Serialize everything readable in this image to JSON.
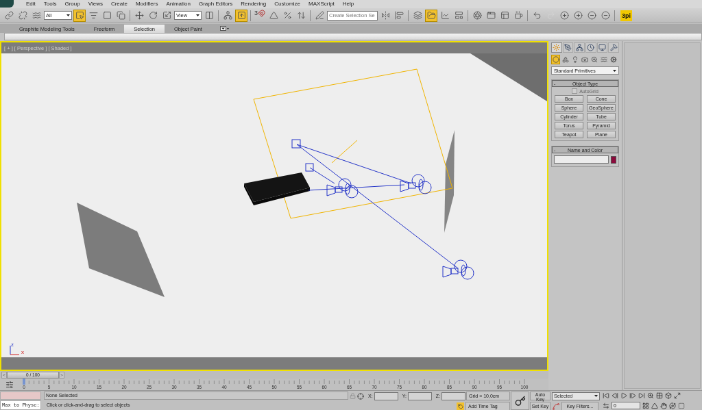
{
  "menu": [
    "Edit",
    "Tools",
    "Group",
    "Views",
    "Create",
    "Modifiers",
    "Animation",
    "Graph Editors",
    "Rendering",
    "Customize",
    "MAXScript",
    "Help"
  ],
  "toolbar": [
    {
      "kind": "button",
      "active": false,
      "disabled": false
    },
    {
      "kind": "button",
      "active": false,
      "disabled": false
    },
    {
      "kind": "button",
      "active": false,
      "disabled": false
    },
    {
      "kind": "dropdown",
      "value": "All"
    },
    {
      "kind": "button",
      "active": true,
      "disabled": false
    },
    {
      "kind": "button",
      "active": false,
      "disabled": false
    },
    {
      "kind": "button",
      "active": false,
      "disabled": false
    },
    {
      "kind": "button",
      "active": false,
      "disabled": false
    },
    {
      "kind": "separator"
    },
    {
      "kind": "button",
      "active": false,
      "disabled": false
    },
    {
      "kind": "button",
      "active": false,
      "disabled": false
    },
    {
      "kind": "button",
      "active": false,
      "disabled": false
    },
    {
      "kind": "dropdown",
      "value": "View"
    },
    {
      "kind": "button",
      "active": false,
      "disabled": false
    },
    {
      "kind": "separator"
    },
    {
      "kind": "button",
      "active": false,
      "disabled": false
    },
    {
      "kind": "button",
      "active": true,
      "disabled": false
    },
    {
      "kind": "separator"
    },
    {
      "kind": "snap",
      "text": "3"
    },
    {
      "kind": "button",
      "active": false,
      "disabled": false
    },
    {
      "kind": "button",
      "active": false,
      "disabled": false
    },
    {
      "kind": "button",
      "active": false,
      "disabled": false
    },
    {
      "kind": "separator"
    },
    {
      "kind": "button",
      "active": false,
      "disabled": false
    },
    {
      "kind": "field",
      "placeholder": "Create Selection Se"
    },
    {
      "kind": "button",
      "active": false,
      "disabled": false
    },
    {
      "kind": "button",
      "active": false,
      "disabled": false
    },
    {
      "kind": "separator"
    },
    {
      "kind": "button",
      "active": false,
      "disabled": false
    },
    {
      "kind": "button",
      "active": true,
      "disabled": false
    },
    {
      "kind": "button",
      "active": false,
      "disabled": false
    },
    {
      "kind": "button",
      "active": false,
      "disabled": false
    },
    {
      "kind": "separator"
    },
    {
      "kind": "button",
      "active": false,
      "disabled": false
    },
    {
      "kind": "button",
      "active": false,
      "disabled": false
    },
    {
      "kind": "button",
      "active": false,
      "disabled": false
    },
    {
      "kind": "button",
      "active": false,
      "disabled": false
    },
    {
      "kind": "separator"
    },
    {
      "kind": "button",
      "active": false,
      "disabled": false
    },
    {
      "kind": "button",
      "active": false,
      "disabled": true
    },
    {
      "kind": "button",
      "active": false,
      "disabled": false
    },
    {
      "kind": "button",
      "active": false,
      "disabled": false
    },
    {
      "kind": "button",
      "active": false,
      "disabled": false
    },
    {
      "kind": "button",
      "active": false,
      "disabled": false
    },
    {
      "kind": "separator"
    },
    {
      "kind": "badge",
      "text": "3pi"
    }
  ],
  "ribbon": {
    "tabs": [
      {
        "label": "Graphite Modeling Tools",
        "selected": false
      },
      {
        "label": "Freeform",
        "selected": false
      },
      {
        "label": "Selection",
        "selected": true
      },
      {
        "label": "Object Paint",
        "selected": false
      }
    ]
  },
  "viewport": {
    "label": "[ + ] [ Perspective ] [ Shaded ]",
    "axis_labels": [
      "z",
      "x"
    ]
  },
  "command_panel": {
    "tabs": [
      {
        "selected": true
      },
      {
        "selected": false
      },
      {
        "selected": false
      },
      {
        "selected": false
      },
      {
        "selected": false
      },
      {
        "selected": false
      }
    ],
    "categories": [
      {
        "selected": true
      },
      {
        "selected": false
      },
      {
        "selected": false
      },
      {
        "selected": false
      },
      {
        "selected": false
      },
      {
        "selected": false
      },
      {
        "selected": false
      }
    ],
    "dropdown": "Standard Primitives",
    "object_type": {
      "sign": "-",
      "title": "Object Type",
      "autogrid": {
        "label": "AutoGrid",
        "checked": false,
        "disabled": true
      },
      "buttons": [
        "Box",
        "Cone",
        "Sphere",
        "GeoSphere",
        "Cylinder",
        "Tube",
        "Torus",
        "Pyramid",
        "Teapot",
        "Plane"
      ]
    },
    "name_and_color": {
      "sign": "-",
      "title": "Name and Color",
      "color": "#8c0a3c"
    }
  },
  "time_slider": {
    "prev": "<",
    "position": "0 / 100",
    "next": ">"
  },
  "track_bar": {
    "ticks": [
      "0",
      "5",
      "10",
      "15",
      "20",
      "25",
      "30",
      "35",
      "40",
      "45",
      "50",
      "55",
      "60",
      "65",
      "70",
      "75",
      "80",
      "85",
      "90",
      "95",
      "100"
    ]
  },
  "status": {
    "script_listener": "Max to Physc:",
    "selection": "None Selected",
    "prompt": "Click or click-and-drag to select objects",
    "x_label": "X:",
    "y_label": "Y:",
    "z_label": "Z:",
    "grid": "Grid = 10,0cm",
    "time_tag": "Add Time Tag",
    "auto_key": "Auto Key",
    "key_mode": "Selected",
    "set_key": "Set Key",
    "key_filters": "Key Filters...",
    "frame": "0"
  }
}
